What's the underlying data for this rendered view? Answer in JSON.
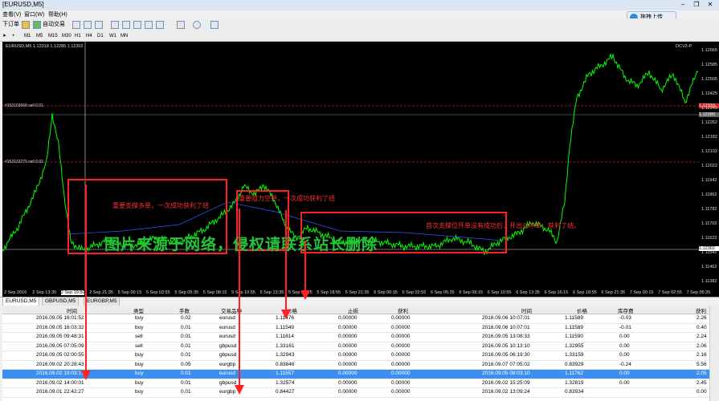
{
  "window": {
    "title": "[EURUSD,M5]"
  },
  "upload_button": {
    "label": "拖拽上传"
  },
  "menu": [
    "查看(V)",
    "窗口(W)",
    "帮助(H)"
  ],
  "toolbar": {
    "new_order": "下订单",
    "auto_trade": "自动交易"
  },
  "timeframes": [
    "M1",
    "M5",
    "M15",
    "M30",
    "H1",
    "H4",
    "D1",
    "W1",
    "MN"
  ],
  "chart": {
    "symbol_info": "EURUSD,M5  1.12318  1.12285  1.12302",
    "indicator_label": "DCV2-P",
    "hline1_label": "#163103668 sell 0.01",
    "hline2_label": "#163132279 sell 0.02",
    "watermark": "图片来源于网络，侵权请联系站长删除",
    "annotation1": "重要支撑多单，一次成功获利了结",
    "annotation2": "重要阻力空单，一次成功获利了结",
    "annotation3": "首次支撑位开单没有成功后，开出对冲单，获利了结。",
    "price_labels": [
      "1.12665",
      "1.12585",
      "1.12505",
      "1.12425",
      "1.12345",
      "1.12262",
      "1.12182",
      "1.12102",
      "1.12022",
      "1.11942",
      "1.11862",
      "1.11782",
      "1.11702",
      "1.11622",
      "1.11542",
      "1.11462",
      "1.11382"
    ],
    "current_price": "1.12302",
    "hline_price_tags": [
      "1.12333",
      "1.12280"
    ],
    "time_labels": [
      "2 Sep 2016",
      "2 Sep 13:35",
      "2 Sep 19:50",
      "2 Sep 21:35",
      "5 Sep 00:15",
      "5 Sep 02:55",
      "5 Sep 05:35",
      "5 Sep 08:15",
      "5 Sep 10:55",
      "5 Sep 13:35",
      "5 Sep 16:15",
      "5 Sep 18:55",
      "5 Sep 21:35",
      "6 Sep 00:15",
      "6 Sep 02:55",
      "6 Sep 05:35",
      "6 Sep 08:15",
      "6 Sep 10:55",
      "6 Sep 13:35",
      "6 Sep 16:15",
      "6 Sep 18:55",
      "6 Sep 21:35",
      "7 Sep 00:15",
      "7 Sep 02:55",
      "7 Sep 05:35"
    ]
  },
  "chart_tabs": [
    "EURUSD,M5",
    "GBPUSD,M5",
    "EURGBP,M5"
  ],
  "table": {
    "headers": [
      "时间",
      "类型",
      "手数",
      "交易品种",
      "价格",
      "止损",
      "获利",
      "时间",
      "价格",
      "库存费",
      "获利"
    ],
    "rows": [
      [
        "2016.09.05 16:01:52",
        "buy",
        "0.02",
        "eurusd",
        "1.11476",
        "0.00000",
        "0.00000",
        "2016.09.06 10:07:01",
        "1.11589",
        "-0.03",
        "2.26"
      ],
      [
        "2016.09.05 16:03:32",
        "buy",
        "0.01",
        "eurusd",
        "1.11549",
        "0.00000",
        "0.00000",
        "2016.09.06 10:07:01",
        "1.11589",
        "-0.01",
        "0.40"
      ],
      [
        "2016.09.05 09:48:31",
        "sell",
        "0.01",
        "eurusd",
        "1.11814",
        "0.00000",
        "0.00000",
        "2016.09.05 13:08:33",
        "1.11590",
        "0.00",
        "2.24"
      ],
      [
        "2016.09.05 07:05:09",
        "sell",
        "0.01",
        "gbpusd",
        "1.33161",
        "0.00000",
        "0.00000",
        "2016.09.05 10:13:10",
        "1.32955",
        "0.00",
        "2.06"
      ],
      [
        "2016.09.05 02:00:55",
        "buy",
        "0.01",
        "gbpusd",
        "1.32943",
        "0.00000",
        "0.00000",
        "2016.09.05 06:19:30",
        "1.33159",
        "0.00",
        "2.16"
      ],
      [
        "2016.09.02 20:28:43",
        "buy",
        "0.05",
        "eurgbp",
        "0.83846",
        "0.00000",
        "0.00000",
        "2016.09.07 07:05:02",
        "0.83929",
        "-0.24",
        "5.56"
      ],
      [
        "2016.09.02 19:03:17",
        "buy",
        "0.01",
        "eurusd",
        "1.11557",
        "0.00000",
        "0.00000",
        "2016.09.05 08:03:10",
        "1.11762",
        "0.00",
        "2.05"
      ],
      [
        "2016.09.02 14:00:01",
        "buy",
        "0.01",
        "gbpusd",
        "1.32574",
        "0.00000",
        "0.00000",
        "2016.09.02 15:25:09",
        "1.32819",
        "0.00",
        "2.45"
      ],
      [
        "2016.09.01 22:42:27",
        "buy",
        "0.01",
        "eurgbp",
        "0.84427",
        "0.00000",
        "0.00000",
        "2016.09.02 13:09:24",
        "0.83934",
        "",
        "0.00"
      ]
    ]
  },
  "colors": {
    "bull": "#00ff00",
    "chart_bg": "#000000",
    "annotation": "#ff3030",
    "selected_row": "#3c8ff0",
    "watermark": "#26c43a"
  }
}
